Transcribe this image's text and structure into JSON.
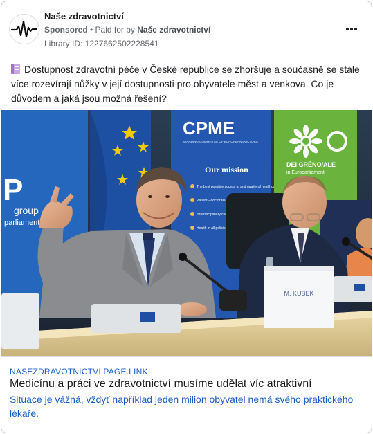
{
  "post": {
    "page_name": "Naše zdravotnictví",
    "sponsored": "Sponsored",
    "paid_for_prefix": " • Paid for by ",
    "paid_for_name": "Naše zdravotnictví",
    "library_id": "Library ID: 1227662502228541",
    "more_icon": "ellipsis-icon",
    "avatar_icon": "heartbeat-icon",
    "body": "Dostupnost zdravotní péče v České republice se zhoršuje a současně se stále více rozevírají nůžky v její dostupnosti pro obyvatele měst a venkova. Co je důvodem a jaká jsou možná řešení?"
  },
  "photo": {
    "left_banner_logo": "P",
    "left_banner_line1": "group",
    "left_banner_line2": "parliament",
    "center_banner_logo": "CPME",
    "center_banner_sub": "STANDING COMMITTEE OF EUROPEAN DOCTORS",
    "center_banner_heading": "Our mission",
    "center_banner_items": [
      "The best possible access to and quality of healthcare for everyone",
      "Patient—doctor relationship fundamental for good care",
      "Interdisciplinary cooperation between doctors & other health professionals",
      "Health in all policies"
    ],
    "right_banner_logo_line1": "DEI GRÉNO/ALE",
    "right_banner_logo_line2": "in Europarliament",
    "name_card": "M. KUBEK"
  },
  "link": {
    "domain": "NASEZDRAVOTNICTVI.PAGE.LINK",
    "title": "Medicínu a práci ve zdravotnictví musíme udělat víc atraktivní",
    "description": "Situace je vážná, vždyť například jeden milion obyvatel nemá svého praktického lékaře."
  },
  "colors": {
    "link_blue": "#1a5fc8",
    "eu_blue": "#1d4fa3",
    "green_banner": "#6ab43e"
  }
}
